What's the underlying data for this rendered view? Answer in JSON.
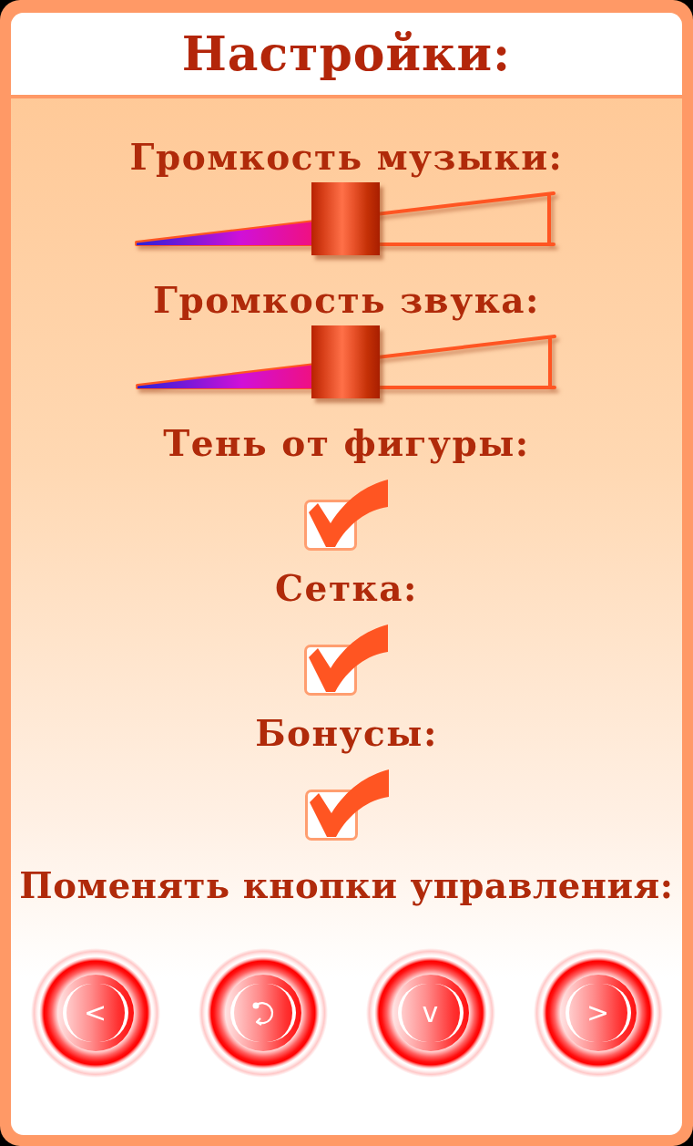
{
  "title": "Настройки:",
  "settings": [
    {
      "kind": "slider",
      "label": "Громкость музыки:",
      "level": 0.5
    },
    {
      "kind": "slider",
      "label": "Громкость звука:",
      "level": 0.5
    },
    {
      "kind": "checkbox",
      "label": "Тень от фигуры:",
      "checked": true
    },
    {
      "kind": "checkbox",
      "label": "Сетка:",
      "checked": true
    },
    {
      "kind": "checkbox",
      "label": "Бонусы:",
      "checked": true
    }
  ],
  "controls": {
    "label": "Поменять кнопки управления:",
    "buttons": [
      {
        "kind": "left",
        "symbol": "<"
      },
      {
        "kind": "rotate"
      },
      {
        "kind": "down",
        "symbol": "v"
      },
      {
        "kind": "right",
        "symbol": ">"
      }
    ]
  }
}
